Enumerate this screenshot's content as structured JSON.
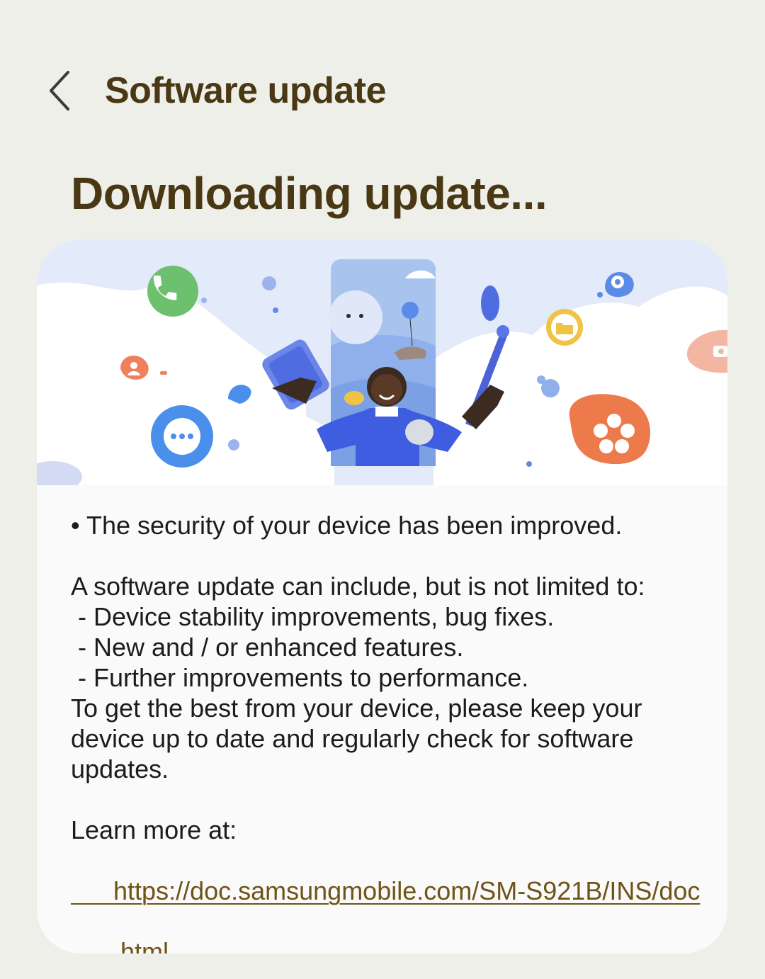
{
  "app_bar": {
    "title": "Software update",
    "back_icon": "chevron-left-icon"
  },
  "status": {
    "title": "Downloading update..."
  },
  "hero": {
    "description": "",
    "icons": [
      "phone-icon",
      "chat-icon",
      "location-pin-icon",
      "settings-icon",
      "folder-icon",
      "flower-icon",
      "camera-icon"
    ]
  },
  "details": {
    "bullet": "• The security of your device has been improved.",
    "intro": "A software update can include, but is not limited to:",
    "items": [
      " - Device stability improvements, bug fixes.",
      " - New and / or enhanced features.",
      " - Further improvements to performance."
    ],
    "closing_lines": [
      "To get the best from your device, please keep your",
      "device up to date and regularly check for software",
      "updates."
    ],
    "learn_more_label": "Learn more at:",
    "link_lines": [
      "https://doc.samsungmobile.com/SM-S921B/INS/doc",
      ".html"
    ]
  },
  "colors": {
    "background": "#efefe9",
    "card": "#fafafa",
    "title": "#4a3814",
    "link": "#6e5416",
    "body_text": "#1c1c1c"
  }
}
